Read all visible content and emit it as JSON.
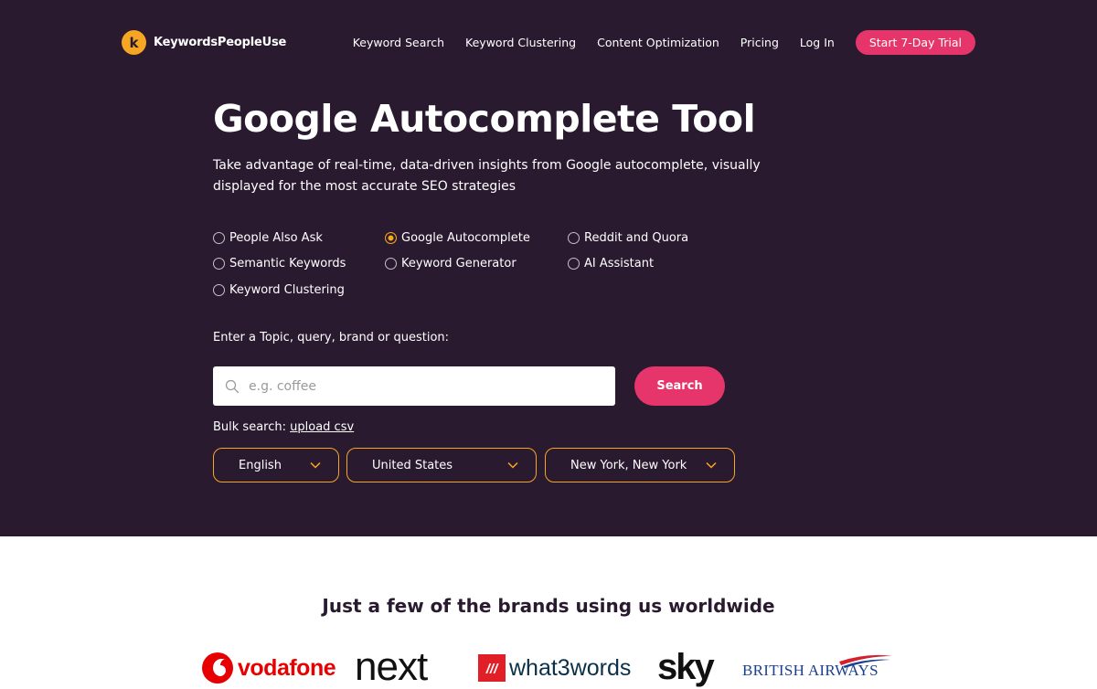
{
  "logo": {
    "text": "KeywordsPeopleUse",
    "mark": "k"
  },
  "nav": {
    "links": [
      "Keyword Search",
      "Keyword Clustering",
      "Content Optimization",
      "Pricing",
      "Log In"
    ],
    "cta": "Start 7-Day Trial"
  },
  "hero": {
    "title": "Google Autocomplete Tool",
    "subtitle": "Take advantage of real-time, data-driven insights from Google autocomplete, visually displayed for the most accurate SEO strategies"
  },
  "modes": [
    {
      "label": "People Also Ask",
      "checked": false
    },
    {
      "label": "Semantic Keywords",
      "checked": false
    },
    {
      "label": "Keyword Clustering",
      "checked": false
    },
    {
      "label": "Google Autocomplete",
      "checked": true
    },
    {
      "label": "Keyword Generator",
      "checked": false
    },
    {
      "label": "Reddit and Quora",
      "checked": false
    },
    {
      "label": "AI Assistant",
      "checked": false
    }
  ],
  "search": {
    "label": "Enter a Topic, query, brand or question:",
    "placeholder": "e.g. coffee",
    "value": "",
    "button": "Search",
    "bulk_prefix": "Bulk search:",
    "bulk_link": "upload csv"
  },
  "selects": {
    "language": "English",
    "country": "United States",
    "location": "New York, New York"
  },
  "brands": {
    "title": "Just a few of the brands using us worldwide",
    "logos": [
      "vodafone",
      "next",
      "what3words",
      "sky",
      "BRITISH AIRWAYS"
    ]
  },
  "colors": {
    "hero_bg": "#2a1a2f",
    "accent_pink": "#e6356a",
    "accent_orange": "#f5a623"
  }
}
